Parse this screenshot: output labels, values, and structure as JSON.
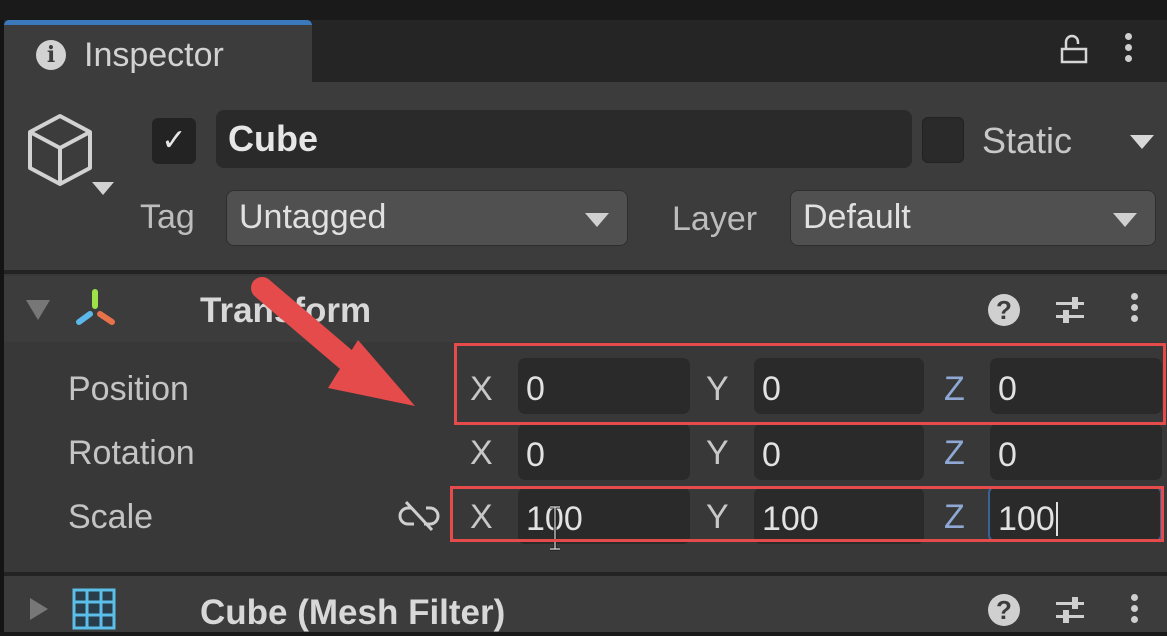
{
  "tab": {
    "label": "Inspector",
    "icon": "info-icon"
  },
  "tab_actions": {
    "lock_icon": "lock-open-icon",
    "menu_icon": "kebab-menu-icon"
  },
  "game_object": {
    "icon": "cube-icon",
    "active": true,
    "active_glyph": "✓",
    "name": "Cube",
    "static_checked": false,
    "static_label": "Static",
    "tag_label": "Tag",
    "tag_value": "Untagged",
    "layer_label": "Layer",
    "layer_value": "Default"
  },
  "components": [
    {
      "title": "Transform",
      "expanded": true,
      "icon": "transform-icon",
      "help_glyph": "?",
      "rows": [
        {
          "label": "Position",
          "x": "0",
          "y": "0",
          "z": "0",
          "highlighted": true
        },
        {
          "label": "Rotation",
          "x": "0",
          "y": "0",
          "z": "0",
          "highlighted": false
        },
        {
          "label": "Scale",
          "x": "100",
          "y": "100",
          "z": "100",
          "highlighted": true,
          "constrain_proportions": false,
          "editing_field": "z"
        }
      ],
      "axis_labels": {
        "x": "X",
        "y": "Y",
        "z": "Z"
      }
    },
    {
      "title": "Cube (Mesh Filter)",
      "expanded": false,
      "icon": "mesh-filter-grid-icon",
      "help_glyph": "?"
    }
  ],
  "annotation": {
    "color": "#e54b4b",
    "type": "arrow-pointing-to-position-row"
  },
  "colors": {
    "tab_accent": "#3a79bb",
    "panel_bg": "#383838",
    "field_bg": "#2a2a2a",
    "z_axis": "#8fa9d4"
  }
}
